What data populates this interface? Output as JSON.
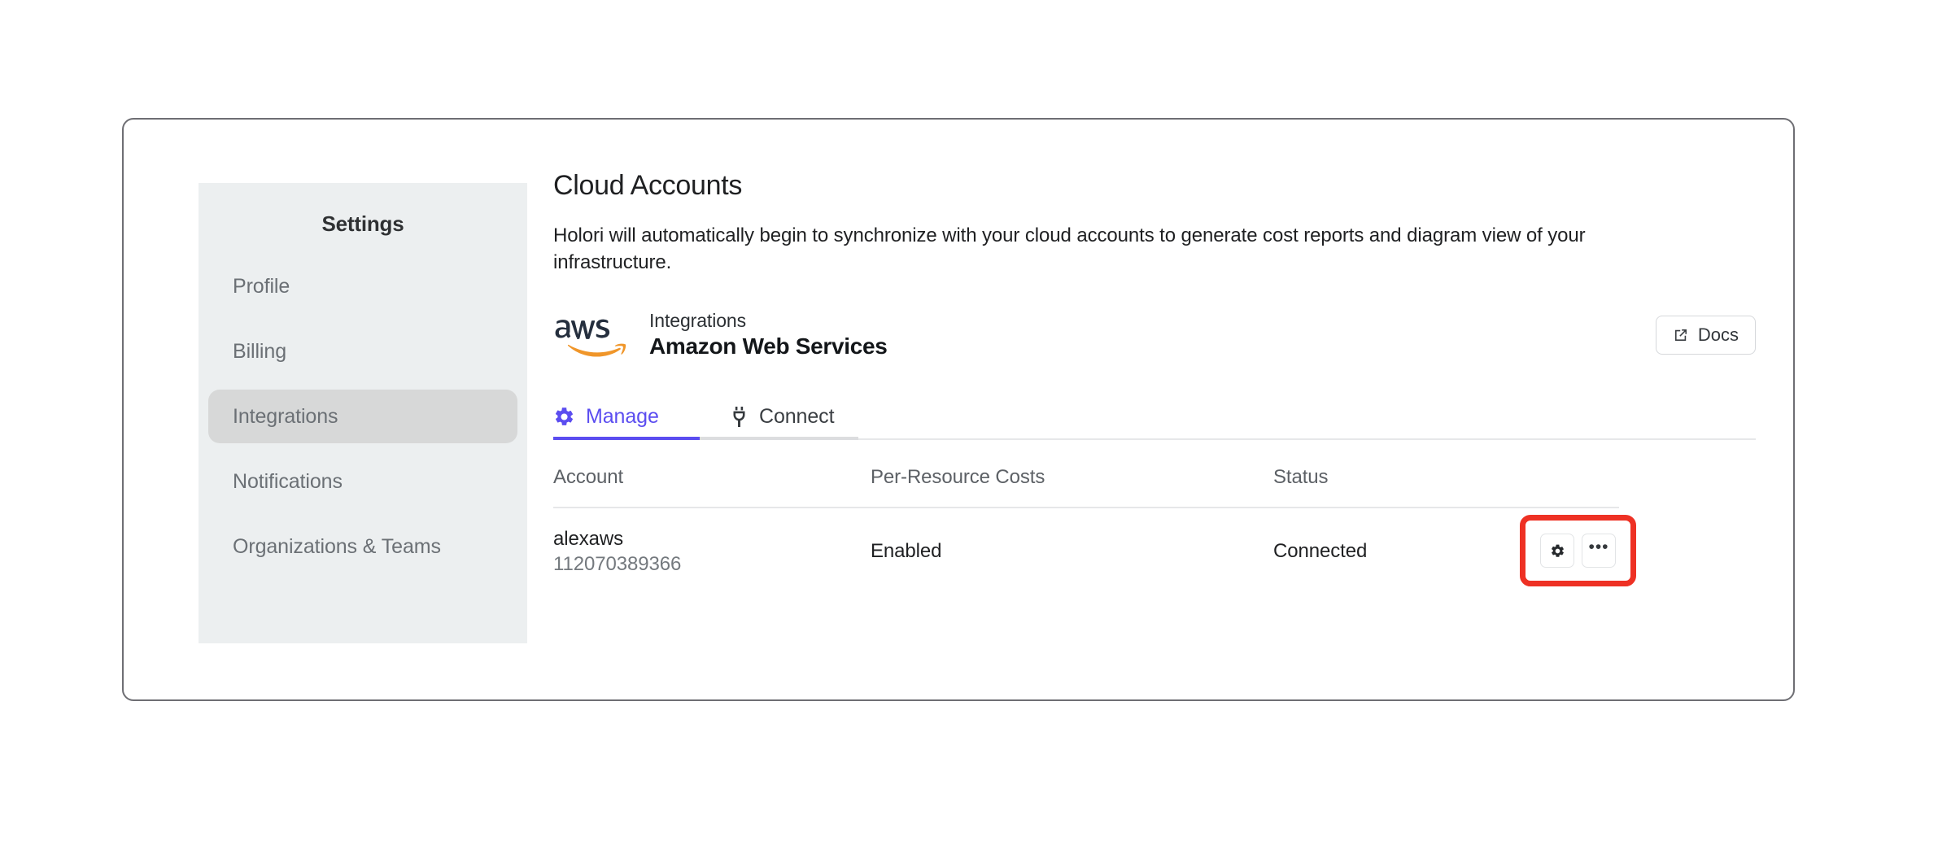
{
  "sidebar": {
    "title": "Settings",
    "items": [
      {
        "label": "Profile",
        "active": false
      },
      {
        "label": "Billing",
        "active": false
      },
      {
        "label": "Integrations",
        "active": true
      },
      {
        "label": "Notifications",
        "active": false
      },
      {
        "label": "Organizations & Teams",
        "active": false
      }
    ]
  },
  "main": {
    "page_title": "Cloud Accounts",
    "page_description": "Holori will automatically begin to synchronize with your cloud accounts to generate cost reports and diagram view of your infrastructure.",
    "integration": {
      "logo": "aws-logo",
      "kicker": "Integrations",
      "name": "Amazon Web Services",
      "docs_label": "Docs",
      "docs_icon": "external-link-icon"
    },
    "tabs": [
      {
        "label": "Manage",
        "icon": "gear-icon",
        "active": true
      },
      {
        "label": "Connect",
        "icon": "plug-icon",
        "active": false
      }
    ],
    "table": {
      "columns": [
        "Account",
        "Per-Resource Costs",
        "Status"
      ],
      "rows": [
        {
          "account_name": "alexaws",
          "account_id": "112070389366",
          "per_resource_costs": "Enabled",
          "status": "Connected",
          "actions": [
            {
              "icon": "gear-icon",
              "name": "settings-button"
            },
            {
              "icon": "ellipsis-icon",
              "name": "more-options-button",
              "label": "•••"
            }
          ]
        }
      ]
    }
  },
  "colors": {
    "accent_purple": "#5b4df0",
    "highlight_red": "#ee3124",
    "sidebar_bg": "#eceff0",
    "sidebar_active_bg": "#d7d8d8",
    "aws_orange": "#f0962a",
    "aws_navy": "#252f3e"
  }
}
